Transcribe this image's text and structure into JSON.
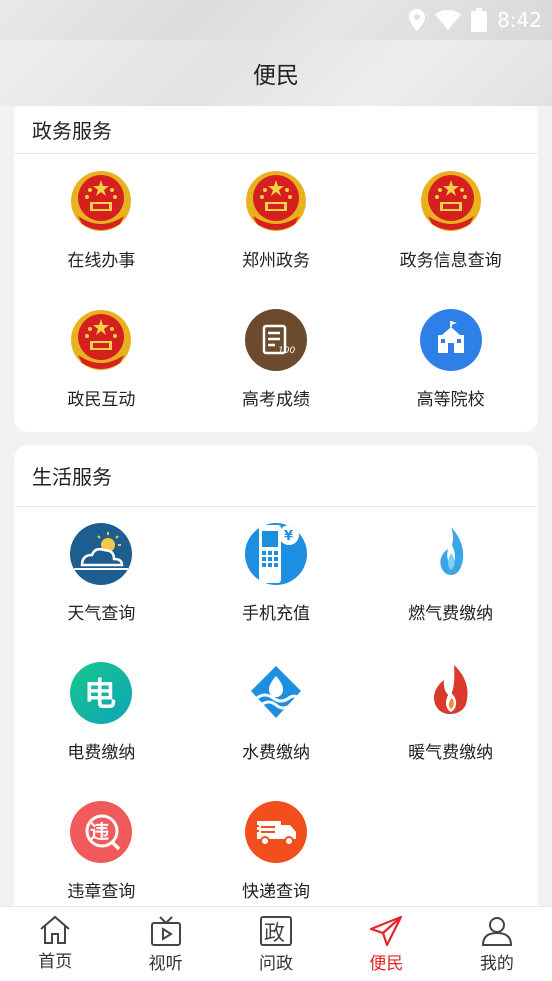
{
  "status": {
    "time": "8:42"
  },
  "header": {
    "title": "便民"
  },
  "gov": {
    "title": "政务服务",
    "items": [
      {
        "label": "在线办事",
        "icon": "emblem-icon"
      },
      {
        "label": "郑州政务",
        "icon": "emblem-icon"
      },
      {
        "label": "政务信息查询",
        "icon": "emblem-icon"
      },
      {
        "label": "政民互动",
        "icon": "emblem-icon"
      },
      {
        "label": "高考成绩",
        "icon": "exam-score-icon"
      },
      {
        "label": "高等院校",
        "icon": "university-icon"
      }
    ]
  },
  "life": {
    "title": "生活服务",
    "items": [
      {
        "label": "天气查询",
        "icon": "weather-icon"
      },
      {
        "label": "手机充值",
        "icon": "phone-recharge-icon"
      },
      {
        "label": "燃气费缴纳",
        "icon": "gas-flame-icon"
      },
      {
        "label": "电费缴纳",
        "icon": "electricity-icon"
      },
      {
        "label": "水费缴纳",
        "icon": "water-icon"
      },
      {
        "label": "暖气费缴纳",
        "icon": "heating-flame-icon"
      },
      {
        "label": "违章查询",
        "icon": "violation-icon"
      },
      {
        "label": "快递查询",
        "icon": "delivery-truck-icon"
      }
    ]
  },
  "tabs": [
    {
      "label": "首页",
      "icon": "home-icon"
    },
    {
      "label": "视听",
      "icon": "tv-icon"
    },
    {
      "label": "问政",
      "icon": "zheng-icon"
    },
    {
      "label": "便民",
      "icon": "paper-plane-icon",
      "active": true
    },
    {
      "label": "我的",
      "icon": "user-icon"
    }
  ],
  "colors": {
    "accent": "#e3262a",
    "emblem_red": "#d61f1f",
    "emblem_gold": "#e8b21e"
  }
}
